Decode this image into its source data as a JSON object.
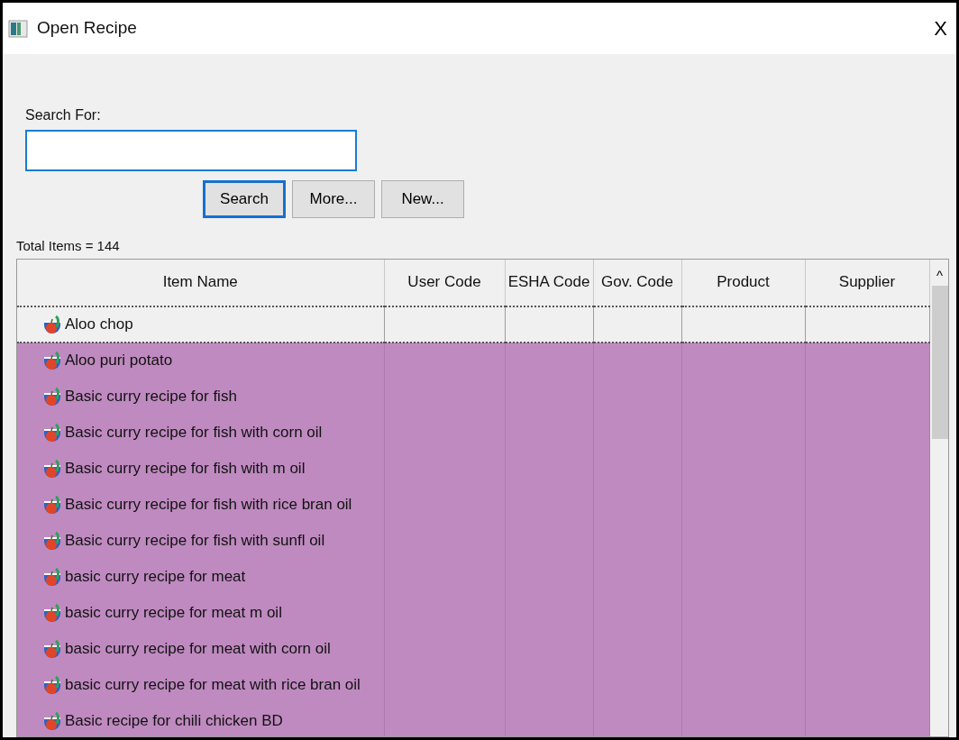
{
  "window": {
    "title": "Open Recipe",
    "close": "X"
  },
  "search": {
    "label": "Search For:"
  },
  "buttons": [
    {
      "label": "Search",
      "default": true
    },
    {
      "label": "More...",
      "default": false
    },
    {
      "label": "New...",
      "default": false
    }
  ],
  "total": "Total Items = 144",
  "table": {
    "columns": [
      "Item Name",
      "User Code",
      "ESHA Code",
      "Gov. Code",
      "Product",
      "Supplier"
    ],
    "rows": [
      {
        "name": "Aloo chop",
        "selected": false,
        "focused": true
      },
      {
        "name": "Aloo puri potato",
        "selected": true,
        "focused": false
      },
      {
        "name": "Basic curry recipe for fish",
        "selected": true,
        "focused": false
      },
      {
        "name": "Basic curry recipe for fish with corn oil",
        "selected": true,
        "focused": false
      },
      {
        "name": "Basic curry recipe for fish with m oil",
        "selected": true,
        "focused": false
      },
      {
        "name": "Basic curry recipe for fish with rice bran oil",
        "selected": true,
        "focused": false
      },
      {
        "name": "Basic curry recipe for fish with sunfl oil",
        "selected": true,
        "focused": false
      },
      {
        "name": "basic curry recipe for meat",
        "selected": true,
        "focused": false
      },
      {
        "name": "basic curry recipe for meat m oil",
        "selected": true,
        "focused": false
      },
      {
        "name": "basic curry recipe for meat with corn oil",
        "selected": true,
        "focused": false
      },
      {
        "name": "basic curry recipe for meat with rice bran oil",
        "selected": true,
        "focused": false
      },
      {
        "name": "Basic recipe for chili chicken BD",
        "selected": true,
        "focused": false
      }
    ],
    "scroll_up": "^"
  }
}
